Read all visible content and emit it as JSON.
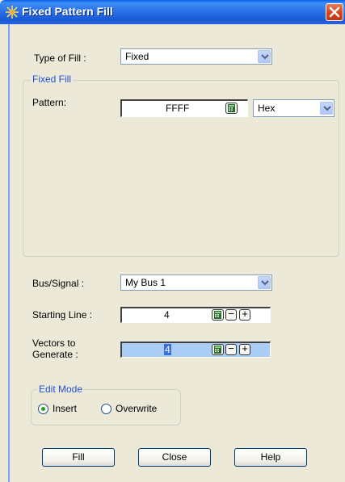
{
  "window": {
    "title": "Fixed Pattern Fill",
    "icon": "snowflake-icon",
    "close_icon": "close-icon"
  },
  "type_of_fill": {
    "label": "Type of Fill :",
    "value": "Fixed"
  },
  "fixed_fill": {
    "legend": "Fixed Fill",
    "pattern_label": "Pattern:",
    "pattern_value": "FFFF",
    "format_value": "Hex"
  },
  "bus_signal": {
    "label": "Bus/Signal :",
    "value": "My Bus 1"
  },
  "starting_line": {
    "label": "Starting Line :",
    "value": "4"
  },
  "vectors": {
    "label_line1": "Vectors to",
    "label_line2": "Generate :",
    "value": "4"
  },
  "edit_mode": {
    "legend": "Edit Mode",
    "options": [
      {
        "label": "Insert",
        "selected": true
      },
      {
        "label": "Overwrite",
        "selected": false
      }
    ]
  },
  "buttons": {
    "fill": "Fill",
    "close": "Close",
    "help": "Help"
  },
  "colors": {
    "title_bar": "#2a72ea",
    "legend_text": "#2250d8",
    "selected_field": "#aacdf5"
  }
}
